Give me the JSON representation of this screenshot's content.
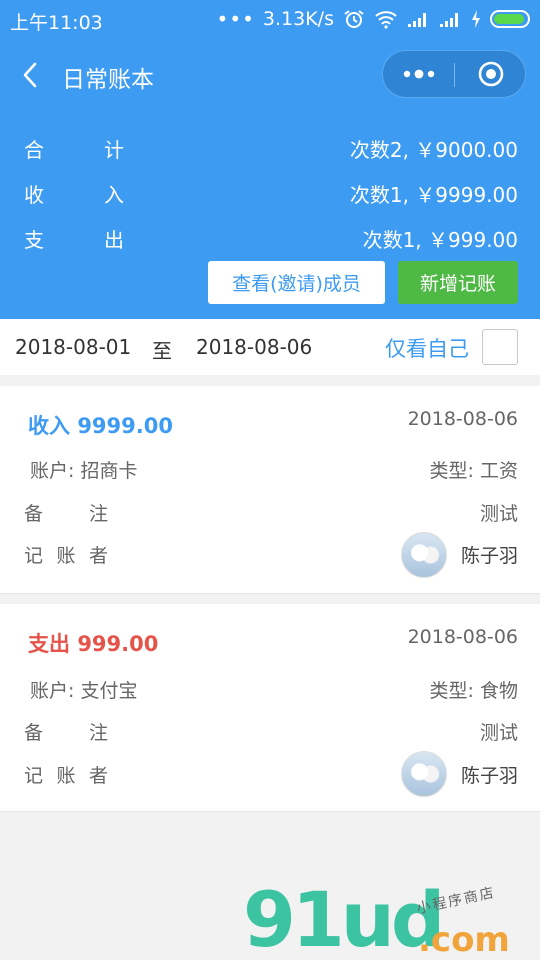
{
  "status_bar": {
    "time": "上午11:03",
    "dots": "•••",
    "speed": "3.13K/s"
  },
  "nav": {
    "title": "日常账本"
  },
  "summary": [
    {
      "label_a": "合",
      "label_b": "计",
      "value": "次数2, ￥9000.00"
    },
    {
      "label_a": "收",
      "label_b": "入",
      "value": "次数1, ￥9999.00"
    },
    {
      "label_a": "支",
      "label_b": "出",
      "value": "次数1, ￥999.00"
    }
  ],
  "buttons": {
    "members": "查看(邀请)成员",
    "add": "新增记账"
  },
  "filter": {
    "start_date": "2018-08-01",
    "to": "至",
    "end_date": "2018-08-06",
    "only_self": "仅看自己"
  },
  "records": [
    {
      "kind": "收入",
      "amount": "9999.00",
      "date": "2018-08-06",
      "account": "账户: 招商卡",
      "category": "类型: 工资",
      "remark_a": "备",
      "remark_b": "注",
      "remark_value": "测试",
      "rec_a": "记",
      "rec_b": "账",
      "rec_c": "者",
      "recorder": "陈子羽"
    },
    {
      "kind": "支出",
      "amount": "999.00",
      "date": "2018-08-06",
      "account": "账户: 支付宝",
      "category": "类型: 食物",
      "remark_a": "备",
      "remark_b": "注",
      "remark_value": "测试",
      "rec_a": "记",
      "rec_b": "账",
      "rec_c": "者",
      "recorder": "陈子羽"
    }
  ],
  "watermark": {
    "logo": "91ud",
    "domain": ".com",
    "tagline": "小程序商店"
  },
  "colors": {
    "header_blue": "#3d9bf2",
    "add_green": "#4fb946",
    "income": "#3d9bf2",
    "expense": "#e5534b"
  }
}
